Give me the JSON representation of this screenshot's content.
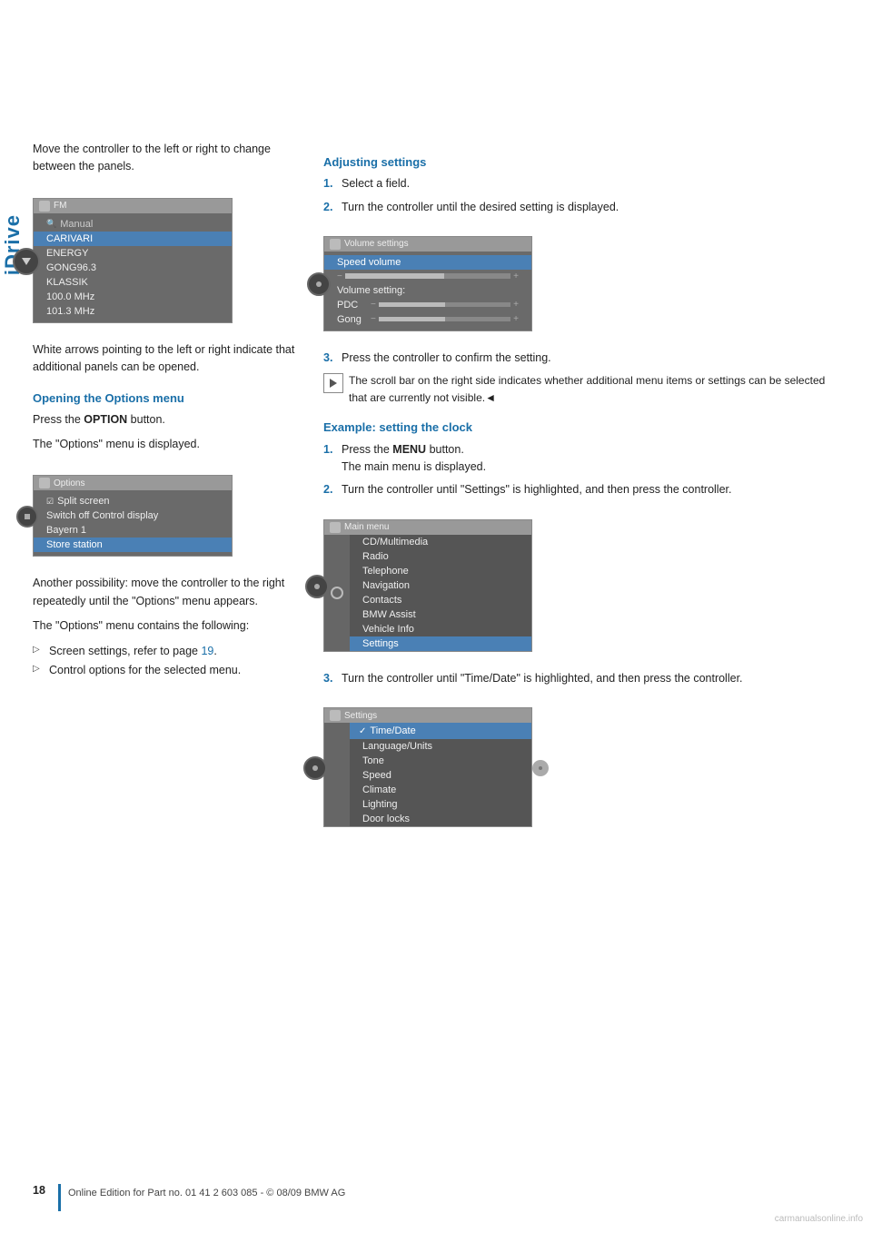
{
  "sidebar": {
    "label": "iDrive"
  },
  "left_col": {
    "intro_text": "Move the controller to the left or right to change between the panels.",
    "fm_screen": {
      "title": "FM",
      "rows": [
        "Manual",
        "CARIVARI",
        "ENERGY",
        "GONG96.3",
        "KLASSIK",
        "100.0 MHz",
        "101.3 MHz"
      ]
    },
    "white_arrows_text": "White arrows pointing to the left or right indicate that additional panels can be opened.",
    "options_heading": "Opening the Options menu",
    "options_para1": "Press the OPTION button.",
    "options_para2": "The \"Options\" menu is displayed.",
    "options_screen": {
      "title": "Options",
      "rows": [
        {
          "text": "Split screen",
          "icon": true,
          "highlighted": false
        },
        {
          "text": "Switch off Control display",
          "highlighted": false
        },
        {
          "text": "Bayern 1",
          "highlighted": false
        },
        {
          "text": "Store station",
          "highlighted": true
        }
      ]
    },
    "another_possibility": "Another possibility: move the controller to the right repeatedly until the \"Options\" menu appears.",
    "contains_text": "The \"Options\" menu contains the following:",
    "bullets": [
      {
        "text": "Screen settings, refer to page 19.",
        "link": "19"
      },
      {
        "text": "Control options for the selected menu."
      }
    ]
  },
  "right_col": {
    "adjusting_heading": "Adjusting settings",
    "adjusting_steps": [
      {
        "num": "1.",
        "text": "Select a field."
      },
      {
        "num": "2.",
        "text": "Turn the controller until the desired setting is displayed."
      }
    ],
    "volume_screen": {
      "title": "Volume settings",
      "speed_volume_label": "Speed volume",
      "volume_setting_label": "Volume setting:",
      "rows": [
        {
          "label": "PDC",
          "bar": true
        },
        {
          "label": "Gong",
          "bar": true
        }
      ]
    },
    "step3_text": "Press the controller to confirm the setting.",
    "scroll_indicator_text": "The scroll bar on the right side indicates whether additional menu items or settings can be selected that are currently not visible.◄",
    "example_heading": "Example: setting the clock",
    "example_steps": [
      {
        "num": "1.",
        "text": "Press the MENU button.\nThe main menu is displayed."
      },
      {
        "num": "2.",
        "text": "Turn the controller until \"Settings\" is highlighted, and then press the controller."
      }
    ],
    "main_menu_screen": {
      "title": "Main menu",
      "rows": [
        {
          "text": "CD/Multimedia",
          "highlighted": false
        },
        {
          "text": "Radio",
          "highlighted": false
        },
        {
          "text": "Telephone",
          "highlighted": false
        },
        {
          "text": "Navigation",
          "highlighted": false
        },
        {
          "text": "Contacts",
          "highlighted": false
        },
        {
          "text": "BMW Assist",
          "highlighted": false
        },
        {
          "text": "Vehicle Info",
          "highlighted": false
        },
        {
          "text": "Settings",
          "highlighted": true
        }
      ]
    },
    "step3b_text": "Turn the controller until \"Time/Date\" is highlighted, and then press the controller.",
    "settings_screen": {
      "title": "Settings",
      "rows": [
        {
          "text": "Time/Date",
          "checked": true,
          "highlighted": true
        },
        {
          "text": "Language/Units",
          "checked": false,
          "highlighted": false
        },
        {
          "text": "Tone",
          "checked": false,
          "highlighted": false
        },
        {
          "text": "Speed",
          "checked": false,
          "highlighted": false
        },
        {
          "text": "Climate",
          "checked": false,
          "highlighted": false
        },
        {
          "text": "Lighting",
          "checked": false,
          "highlighted": false
        },
        {
          "text": "Door locks",
          "checked": false,
          "highlighted": false
        }
      ]
    }
  },
  "footer": {
    "page_number": "18",
    "footer_text": "Online Edition for Part no. 01 41 2 603 085 - © 08/09 BMW AG"
  },
  "watermark": "carmanualsonline.info"
}
